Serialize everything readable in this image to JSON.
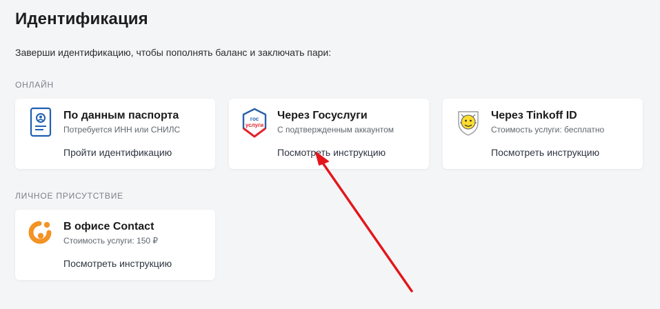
{
  "page": {
    "title": "Идентификация",
    "subtitle": "Заверши идентификацию, чтобы пополнять баланс и заключать пари:"
  },
  "sections": {
    "online_label": "ОНЛАЙН",
    "personal_label": "ЛИЧНОЕ ПРИСУТСТВИЕ"
  },
  "cards": {
    "passport": {
      "icon": "passport-id-icon",
      "title": "По данным паспорта",
      "subtitle": "Потребуется ИНН или СНИЛС",
      "link": "Пройти идентификацию"
    },
    "gosuslugi": {
      "icon": "gosuslugi-logo-icon",
      "logo_text_top": "гос",
      "logo_text_bottom": "услуги",
      "title": "Через Госуслуги",
      "subtitle": "С подтвержденным аккаунтом",
      "link": "Посмотреть инструкцию"
    },
    "tinkoff": {
      "icon": "tinkoff-logo-icon",
      "title": "Через Tinkoff ID",
      "subtitle": "Стоимость услуги: бесплатно",
      "link": "Посмотреть инструкцию"
    },
    "contact": {
      "icon": "contact-logo-icon",
      "title": "В офисе Contact",
      "subtitle": "Стоимость услуги: 150 ₽",
      "link": "Посмотреть инструкцию"
    }
  },
  "colors": {
    "background": "#f4f5f7",
    "card": "#ffffff",
    "passport_blue": "#1f5fb0",
    "gosuslugi_blue": "#2a5fab",
    "gosuslugi_red": "#e2232a",
    "tinkoff_yellow": "#ffdd2d",
    "contact_orange": "#f39324",
    "annotation_arrow": "#e3161b"
  }
}
